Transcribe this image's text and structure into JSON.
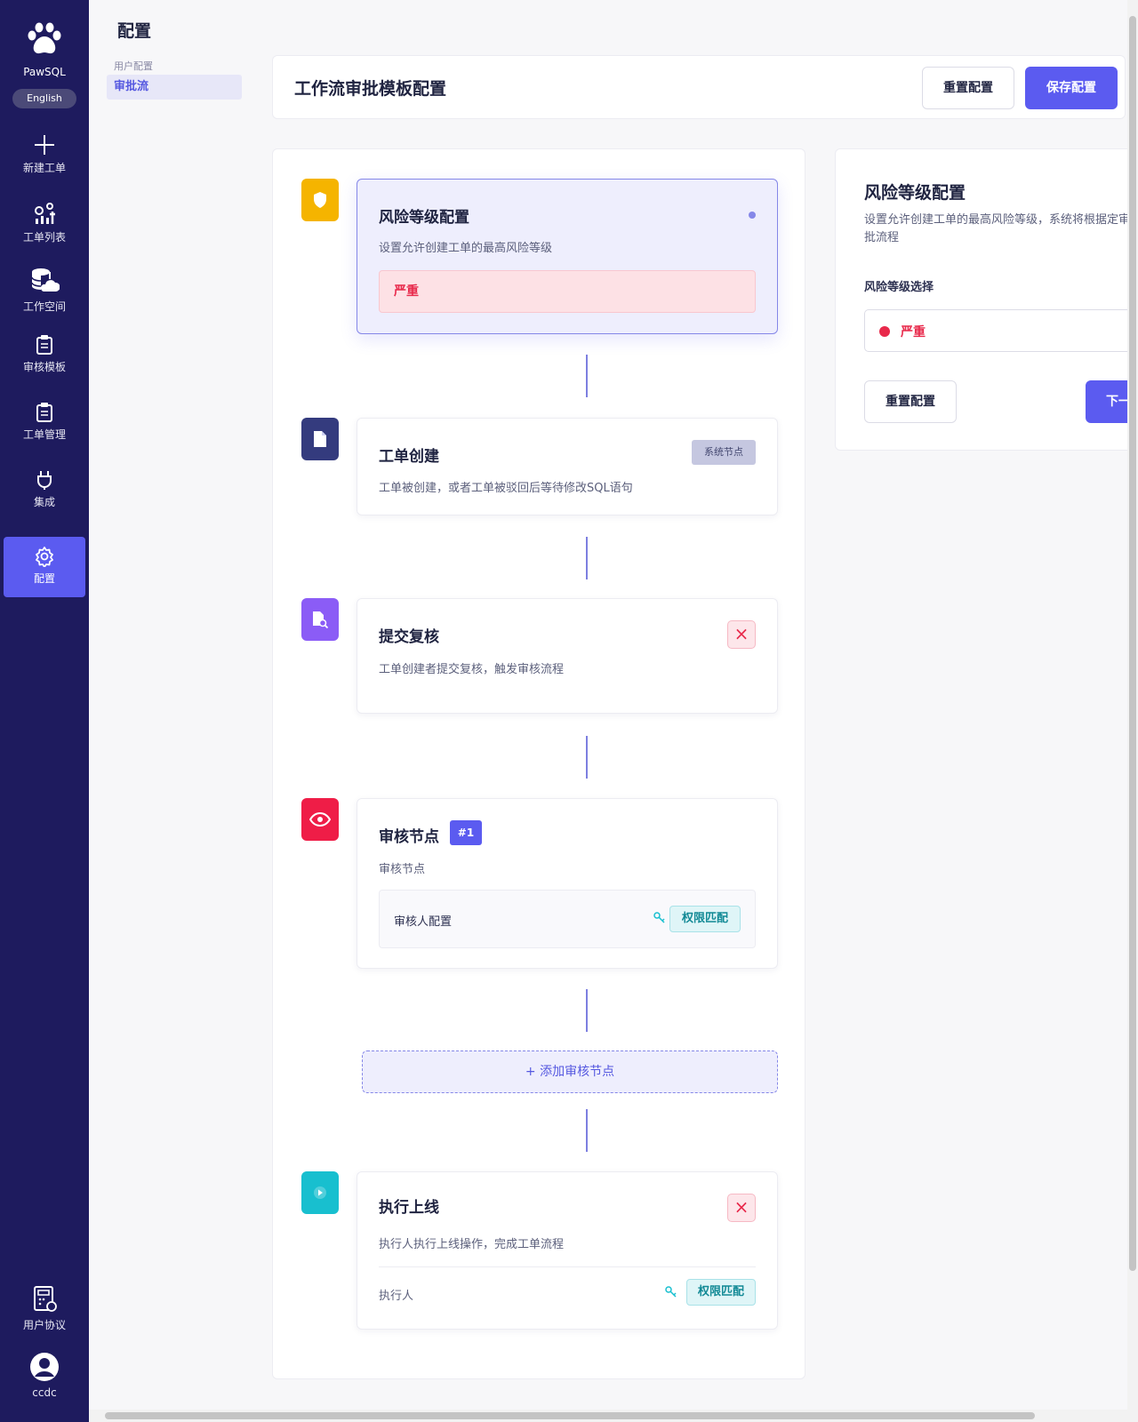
{
  "app": {
    "brand": "PawSQL",
    "language": "English"
  },
  "nav": [
    {
      "label": "新建工单",
      "icon": "plus-icon"
    },
    {
      "label": "工单列表",
      "icon": "gears-chart-icon"
    },
    {
      "label": "工作空间",
      "icon": "database-cloud-icon"
    },
    {
      "label": "审核模板",
      "icon": "clipboard-icon"
    },
    {
      "label": "工单管理",
      "icon": "clipboard-icon"
    },
    {
      "label": "集成",
      "icon": "plug-icon"
    },
    {
      "label": "配置",
      "icon": "gear-icon",
      "active": true
    }
  ],
  "nav_bottom": [
    {
      "label": "用户协议",
      "icon": "calculator-doc-icon"
    },
    {
      "label": "ccdc",
      "icon": "user-avatar-icon"
    }
  ],
  "sub_nav": {
    "title": "配置",
    "group": "用户配置",
    "active_item": "审批流"
  },
  "header": {
    "title": "工作流审批模板配置",
    "reset_label": "重置配置",
    "save_label": "保存配置"
  },
  "workflow": {
    "risk": {
      "title": "风险等级配置",
      "desc": "设置允许创建工单的最高风险等级",
      "level": "严重"
    },
    "create": {
      "title": "工单创建",
      "badge": "系统节点",
      "desc": "工单被创建，或者工单被驳回后等待修改SQL语句"
    },
    "submit": {
      "title": "提交复核",
      "desc": "工单创建者提交复核，触发审核流程",
      "remove": "×"
    },
    "review": {
      "title": "审核节点",
      "badge": "#1",
      "desc": "审核节点",
      "reviewer_label": "审核人配置",
      "match_label": "权限匹配"
    },
    "add_node": "+ 添加审核节点",
    "execute": {
      "title": "执行上线",
      "desc": "执行人执行上线操作，完成工单流程",
      "remove": "×",
      "executor_label": "执行人",
      "match_label": "权限匹配"
    }
  },
  "right_panel": {
    "title": "风险等级配置",
    "desc": "设置允许创建工单的最高风险等级，系统将根据定审批流程",
    "select_label": "风险等级选择",
    "selected": "严重",
    "reset_label": "重置配置",
    "next_label": "下一"
  },
  "colors": {
    "sidebar": "#1e1b5e",
    "primary": "#5b5bf0",
    "danger": "#e8294b",
    "risk_icon": "#f5b400",
    "create_icon": "#343b7e",
    "submit_icon": "#8b5cf6",
    "review_icon": "#ef1d47",
    "execute_icon": "#18bfcf"
  }
}
